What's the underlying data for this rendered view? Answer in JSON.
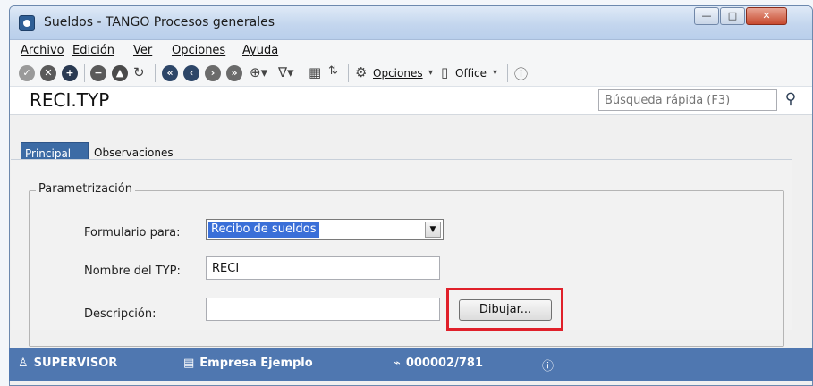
{
  "window": {
    "title": "Sueldos - TANGO Procesos generales",
    "controls": {
      "minimize": "—",
      "maximize": "□",
      "close": "✕"
    }
  },
  "menu": [
    {
      "label": "Archivo"
    },
    {
      "label": "Edición"
    },
    {
      "label": "Ver"
    },
    {
      "label": "Opciones"
    },
    {
      "label": "Ayuda"
    }
  ],
  "toolbar": {
    "options_label": "Opciones",
    "office_label": "Office",
    "icons": [
      "check-icon",
      "cancel-icon",
      "add-icon",
      "remove-icon",
      "up-icon",
      "refresh-icon",
      "first-icon",
      "prev-icon",
      "next-icon",
      "last-icon",
      "binoculars-icon",
      "filter-icon",
      "grid-icon",
      "sort-icon",
      "gear-icon",
      "office-icon",
      "help-icon"
    ]
  },
  "header": {
    "title": "RECI.TYP",
    "search_placeholder": "Búsqueda rápida (F3)"
  },
  "tabs": [
    {
      "label": "Principal",
      "active": true
    },
    {
      "label": "Observaciones",
      "active": false
    }
  ],
  "form": {
    "group_label": "Parametrización",
    "fields": {
      "formulario": {
        "label": "Formulario para:",
        "value": "Recibo de sueldos"
      },
      "nombre": {
        "label": "Nombre del TYP:",
        "value": "RECI"
      },
      "descripcion": {
        "label": "Descripción:",
        "value": ""
      }
    },
    "draw_button": "Dibujar..."
  },
  "status": {
    "user": "SUPERVISOR",
    "company": "Empresa Ejemplo",
    "code": "000002/781"
  },
  "colors": {
    "accent": "#4f77b0",
    "highlight": "#e0202a",
    "selection": "#3a6fd8"
  }
}
